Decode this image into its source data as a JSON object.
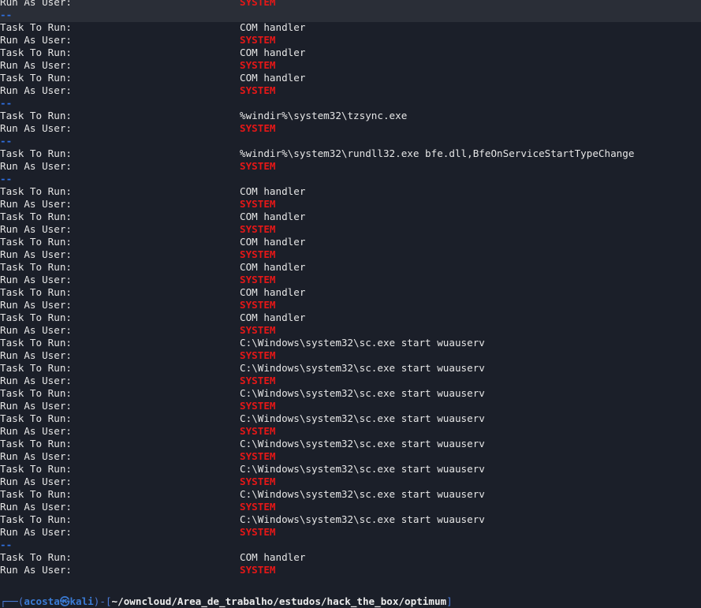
{
  "terminal": {
    "lines": [
      {
        "label": "Run As User:",
        "value": "SYSTEM"
      },
      {
        "separator": "--"
      },
      {
        "label": "Task To Run:",
        "value": "COM handler"
      },
      {
        "label": "Run As User:",
        "value": "SYSTEM"
      },
      {
        "label": "Task To Run:",
        "value": "COM handler"
      },
      {
        "label": "Run As User:",
        "value": "SYSTEM"
      },
      {
        "label": "Task To Run:",
        "value": "COM handler"
      },
      {
        "label": "Run As User:",
        "value": "SYSTEM"
      },
      {
        "separator": "--"
      },
      {
        "label": "Task To Run:",
        "value": "%windir%\\system32\\tzsync.exe"
      },
      {
        "label": "Run As User:",
        "value": "SYSTEM"
      },
      {
        "separator": "--"
      },
      {
        "label": "Task To Run:",
        "value": "%windir%\\system32\\rundll32.exe bfe.dll,BfeOnServiceStartTypeChange"
      },
      {
        "label": "Run As User:",
        "value": "SYSTEM"
      },
      {
        "separator": "--"
      },
      {
        "label": "Task To Run:",
        "value": "COM handler"
      },
      {
        "label": "Run As User:",
        "value": "SYSTEM"
      },
      {
        "label": "Task To Run:",
        "value": "COM handler"
      },
      {
        "label": "Run As User:",
        "value": "SYSTEM"
      },
      {
        "label": "Task To Run:",
        "value": "COM handler"
      },
      {
        "label": "Run As User:",
        "value": "SYSTEM"
      },
      {
        "label": "Task To Run:",
        "value": "COM handler"
      },
      {
        "label": "Run As User:",
        "value": "SYSTEM"
      },
      {
        "label": "Task To Run:",
        "value": "COM handler"
      },
      {
        "label": "Run As User:",
        "value": "SYSTEM"
      },
      {
        "label": "Task To Run:",
        "value": "COM handler"
      },
      {
        "label": "Run As User:",
        "value": "SYSTEM"
      },
      {
        "label": "Task To Run:",
        "value": "C:\\Windows\\system32\\sc.exe start wuauserv"
      },
      {
        "label": "Run As User:",
        "value": "SYSTEM"
      },
      {
        "label": "Task To Run:",
        "value": "C:\\Windows\\system32\\sc.exe start wuauserv"
      },
      {
        "label": "Run As User:",
        "value": "SYSTEM"
      },
      {
        "label": "Task To Run:",
        "value": "C:\\Windows\\system32\\sc.exe start wuauserv"
      },
      {
        "label": "Run As User:",
        "value": "SYSTEM"
      },
      {
        "label": "Task To Run:",
        "value": "C:\\Windows\\system32\\sc.exe start wuauserv"
      },
      {
        "label": "Run As User:",
        "value": "SYSTEM"
      },
      {
        "label": "Task To Run:",
        "value": "C:\\Windows\\system32\\sc.exe start wuauserv"
      },
      {
        "label": "Run As User:",
        "value": "SYSTEM"
      },
      {
        "label": "Task To Run:",
        "value": "C:\\Windows\\system32\\sc.exe start wuauserv"
      },
      {
        "label": "Run As User:",
        "value": "SYSTEM"
      },
      {
        "label": "Task To Run:",
        "value": "C:\\Windows\\system32\\sc.exe start wuauserv"
      },
      {
        "label": "Run As User:",
        "value": "SYSTEM"
      },
      {
        "label": "Task To Run:",
        "value": "C:\\Windows\\system32\\sc.exe start wuauserv"
      },
      {
        "label": "Run As User:",
        "value": "SYSTEM"
      },
      {
        "separator": "--"
      },
      {
        "label": "Task To Run:",
        "value": "COM handler"
      },
      {
        "label": "Run As User:",
        "value": "SYSTEM"
      },
      {
        "blank": true
      }
    ]
  },
  "prompt": {
    "frame_open": "┌──(",
    "user": "acosta",
    "at_icon": "㉿",
    "host": "kali",
    "frame_mid": ")-[",
    "path": "~/owncloud/Area_de_trabalho/estudos/hack_the_box/optimum",
    "frame_close": "]"
  },
  "colors": {
    "background": "#1b1f29",
    "system_highlight": "#e61717",
    "separator": "#2f6fe0",
    "prompt_accent": "#3a7bd5"
  }
}
